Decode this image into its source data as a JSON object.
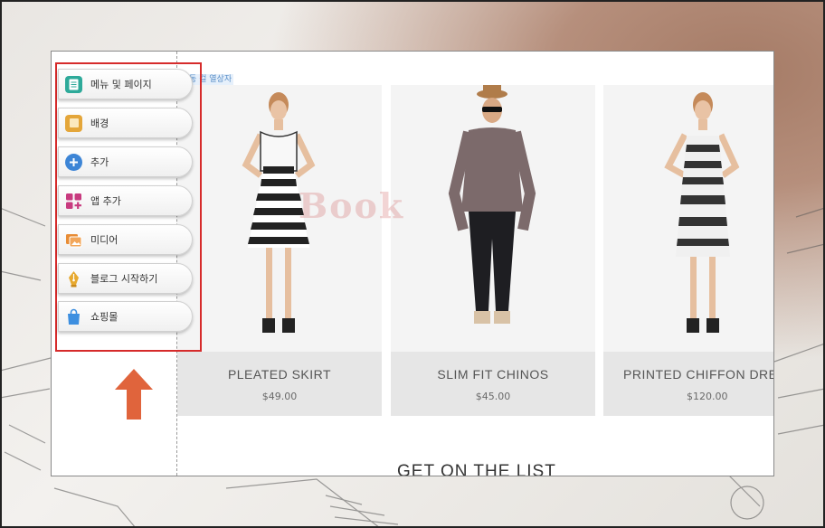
{
  "hint_tag": "동 걸 열상자",
  "menu": [
    {
      "label": "메뉴 및 페이지",
      "icon": "pages-icon",
      "color": "#2eaa9a"
    },
    {
      "label": "배경",
      "icon": "background-icon",
      "color": "#e4a63a"
    },
    {
      "label": "추가",
      "icon": "plus-circle-icon",
      "color": "#3d85d6"
    },
    {
      "label": "앱 추가",
      "icon": "app-grid-icon",
      "color": "#c83a7f"
    },
    {
      "label": "미디어",
      "icon": "media-icon",
      "color": "#e88c35"
    },
    {
      "label": "블로그 시작하기",
      "icon": "pen-nib-icon",
      "color": "#e7a92f"
    },
    {
      "label": "쇼핑몰",
      "icon": "shopping-bag-icon",
      "color": "#3d8fe0"
    }
  ],
  "products": [
    {
      "name": "PLEATED SKIRT",
      "price": "$49.00"
    },
    {
      "name": "SLIM FIT CHINOS",
      "price": "$45.00"
    },
    {
      "name": "PRINTED CHIFFON DRE",
      "price": "$120.00"
    }
  ],
  "footer_title": "GET ON THE LIST",
  "watermark": "Book",
  "colors": {
    "highlight_border": "#d62b2b",
    "arrow": "#e0643c"
  }
}
